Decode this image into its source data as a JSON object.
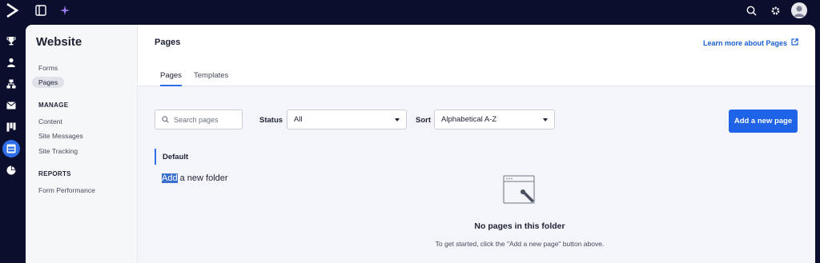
{
  "topbar": {
    "logo_icon": "chevron-logo-icon",
    "panel_icon": "sidebar-toggle-icon",
    "sparkle_icon": "sparkle-icon",
    "search_icon": "search-icon",
    "settings_icon": "gear-icon",
    "avatar_icon": "user-avatar-icon"
  },
  "rail": {
    "items": [
      {
        "icon": "trophy-icon"
      },
      {
        "icon": "person-icon"
      },
      {
        "icon": "org-chart-icon"
      },
      {
        "icon": "envelope-icon"
      },
      {
        "icon": "kanban-icon"
      },
      {
        "icon": "website-icon",
        "active": true
      },
      {
        "icon": "pie-chart-icon"
      }
    ]
  },
  "subnav": {
    "title": "Website",
    "links": {
      "forms": "Forms",
      "pages": "Pages"
    },
    "manage_heading": "MANAGE",
    "manage": {
      "content": "Content",
      "site_messages": "Site Messages",
      "site_tracking": "Site Tracking"
    },
    "reports_heading": "REPORTS",
    "reports": {
      "form_performance": "Form Performance"
    }
  },
  "header": {
    "title": "Pages",
    "learn_link": "Learn more about Pages",
    "tabs": {
      "pages": "Pages",
      "templates": "Templates"
    }
  },
  "filters": {
    "search_placeholder": "Search pages",
    "status_label": "Status",
    "status_value": "All",
    "sort_label": "Sort",
    "sort_value": "Alphabetical A-Z",
    "add_button": "Add a new page"
  },
  "folders": {
    "default": "Default",
    "add_highlight": "Add",
    "add_rest": " a new folder"
  },
  "empty_state": {
    "title": "No pages in this folder",
    "subtitle": "To get started, click the \"Add a new page\" button above."
  },
  "colors": {
    "accent": "#1f63e8",
    "nav_bg": "#0b0e2c",
    "body_bg": "#f3f5fb"
  }
}
